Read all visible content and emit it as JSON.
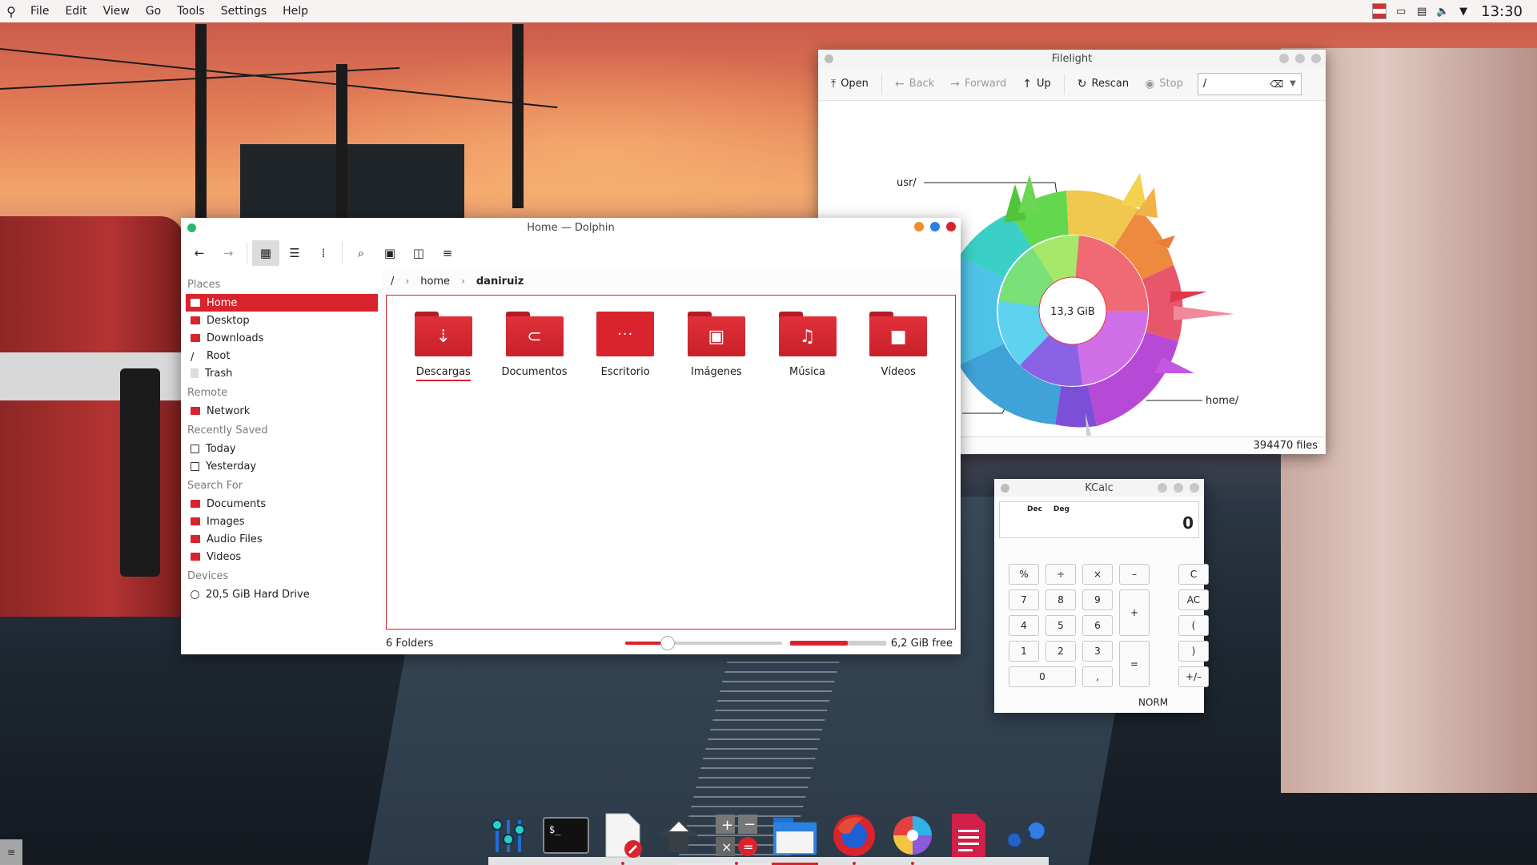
{
  "panel": {
    "menu": [
      "File",
      "Edit",
      "View",
      "Go",
      "Tools",
      "Settings",
      "Help"
    ],
    "clock": "13:30"
  },
  "filelight": {
    "title": "Filelight",
    "toolbar": {
      "open": "Open",
      "back": "Back",
      "forward": "Forward",
      "up": "Up",
      "rescan": "Rescan",
      "stop": "Stop"
    },
    "path": "/",
    "center_label": "13,3 GiB",
    "label_usr": "usr/",
    "label_home": "home/",
    "status": "394470 files"
  },
  "dolphin": {
    "title": "Home — Dolphin",
    "places_heading": "Places",
    "places": [
      "Home",
      "Desktop",
      "Downloads",
      "Root",
      "Trash"
    ],
    "remote_heading": "Remote",
    "remote": [
      "Network"
    ],
    "recent_heading": "Recently Saved",
    "recent": [
      "Today",
      "Yesterday"
    ],
    "search_heading": "Search For",
    "search": [
      "Documents",
      "Images",
      "Audio Files",
      "Videos"
    ],
    "devices_heading": "Devices",
    "devices": [
      "20,5 GiB Hard Drive"
    ],
    "breadcrumb": [
      "/",
      "home",
      "daniruiz"
    ],
    "folders": [
      "Descargas",
      "Documentos",
      "Escritorio",
      "Imágenes",
      "Música",
      "Vídeos"
    ],
    "status_count": "6 Folders",
    "zoom_level": 0.27,
    "used_fraction": 0.6,
    "free_space": "6,2 GiB free"
  },
  "kcalc": {
    "title": "KCalc",
    "flags": [
      "Dec",
      "Deg"
    ],
    "display": "0",
    "keys": {
      "pct": "%",
      "div": "÷",
      "mul": "×",
      "minus": "–",
      "clear": "C",
      "k7": "7",
      "k8": "8",
      "k9": "9",
      "plus": "+",
      "allclear": "AC",
      "k4": "4",
      "k5": "5",
      "k6": "6",
      "lparen": "(",
      "k1": "1",
      "k2": "2",
      "k3": "3",
      "eq": "=",
      "rparen": ")",
      "k0": "0",
      "comma": ",",
      "sign": "+/–"
    },
    "mode": "NORM"
  },
  "colors": {
    "accent": "#d9232d"
  }
}
